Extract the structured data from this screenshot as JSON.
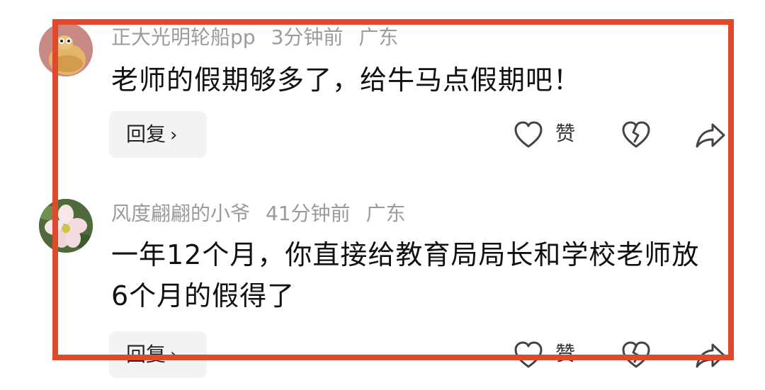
{
  "comments": [
    {
      "username": "正大光明轮船pp",
      "time": "3分钟前",
      "location": "广东",
      "text": "老师的假期够多了，给牛马点假期吧！",
      "reply_label": "回复",
      "like_label": "赞"
    },
    {
      "username": "风度翩翩的小爷",
      "time": "41分钟前",
      "location": "广东",
      "text": "一年12个月，你直接给教育局局长和学校老师放6个月的假得了",
      "reply_label": "回复",
      "like_label": "赞"
    }
  ],
  "icons": {
    "like": "heart-outline-icon",
    "dislike": "broken-heart-icon",
    "share": "share-arrow-icon",
    "reply_chevron": "chevron-right-icon"
  },
  "colors": {
    "highlight_frame": "#e04a2c",
    "meta_text": "#9b9b9b",
    "body_text": "#111111",
    "reply_bg": "#f3f3f3"
  }
}
